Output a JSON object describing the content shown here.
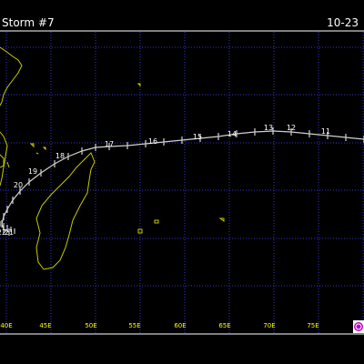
{
  "header": {
    "title": "Storm #7",
    "date": "10-23"
  },
  "map": {
    "longitude_labels": [
      "40E",
      "45E",
      "50E",
      "55E",
      "60E",
      "65E",
      "70E",
      "75E"
    ],
    "grid": true,
    "colors": {
      "background": "#000000",
      "grid": "#3333cc",
      "border": "#ffffff",
      "coastline": "#c8c800",
      "track": "#d0d0d0",
      "day_labels": "#ffffff",
      "axis_labels": "#ffff00"
    },
    "track_day_labels": [
      "13",
      "12",
      "11",
      "14",
      "15",
      "16",
      "17",
      "18",
      "19",
      "20",
      "21",
      "22"
    ],
    "logo_icon": "copyright-badge-icon"
  }
}
